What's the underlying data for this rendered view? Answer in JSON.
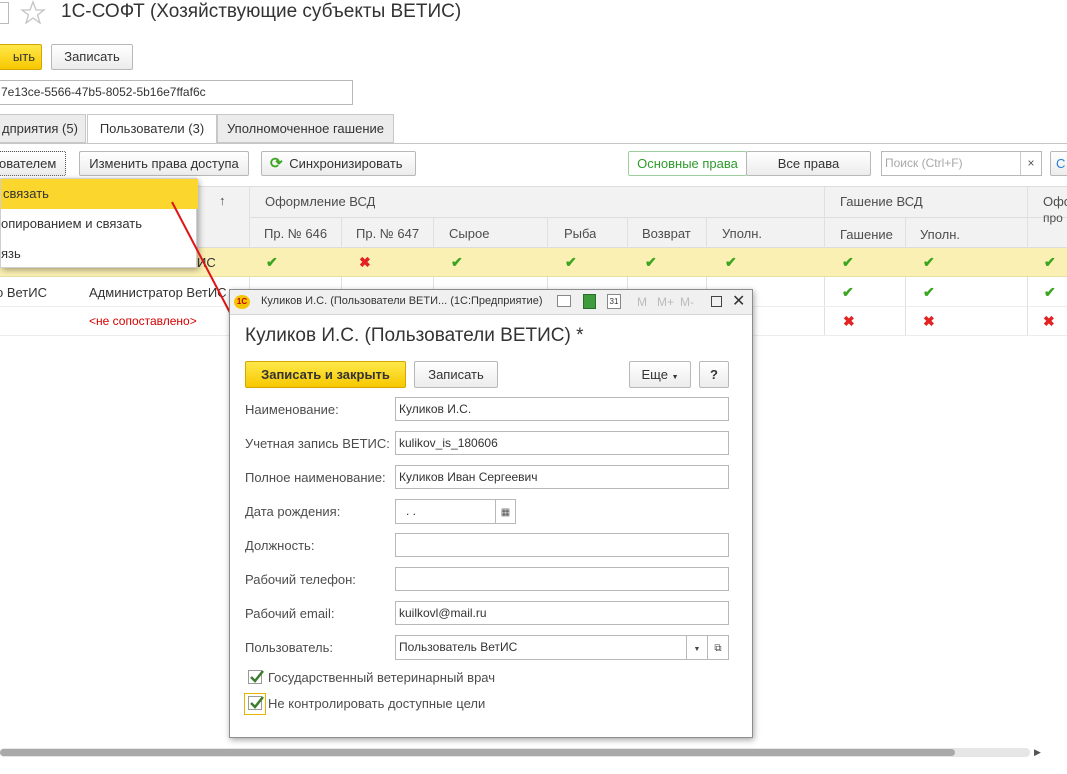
{
  "main": {
    "title": "1С-СОФТ (Хозяйствующие субъекты ВЕТИС)",
    "close_button": "ыть",
    "save_button": "Записать",
    "guid": "7e13ce-5566-47b5-8052-5b16e7ffaf6c",
    "tabs": [
      "дприятия (5)",
      "Пользователи (3)",
      "Уполномоченное гашение"
    ],
    "toolbar": {
      "user_dropdown": "ователем",
      "change_rights": "Изменить права доступа",
      "sync": "Синхронизировать",
      "basic_rights": "Основные права",
      "all_rights": "Все права",
      "search_placeholder": "Поиск (Ctrl+F)"
    },
    "context_menu": [
      "связать",
      "опированием и связать",
      "язь"
    ],
    "table": {
      "group_headers": [
        "Оформление ВСД",
        "Гашение ВСД",
        "Офо",
        "про"
      ],
      "sort_arrow": "↑",
      "columns": [
        "Пр. № 646",
        "Пр. № 647",
        "Сырое",
        "Рыба",
        "Возврат",
        "Уполн.",
        "Гашение",
        "Уполн."
      ],
      "rows": [
        {
          "name": "",
          "user": "ИС",
          "marks": [
            "yes",
            "no",
            "yes",
            "yes",
            "yes",
            "yes",
            "yes",
            "yes",
            "yes"
          ]
        },
        {
          "name": "о ВетИС",
          "user": "Администратор ВетИС",
          "marks": [
            "",
            "",
            "",
            "",
            "",
            "",
            "yes",
            "yes",
            "yes"
          ]
        },
        {
          "name": "",
          "user": "<не сопоставлено>",
          "marks": [
            "",
            "",
            "",
            "",
            "",
            "",
            "no",
            "no",
            "no"
          ]
        }
      ]
    }
  },
  "dialog": {
    "window_title": "Куликов И.С. (Пользователи ВЕТИ... (1С:Предприятие)",
    "heading": "Куликов И.С. (Пользователи ВЕТИС) *",
    "save_close_button": "Записать и закрыть",
    "save_button": "Записать",
    "more_button": "Еще",
    "help_button": "?",
    "titlebar_m": [
      "M",
      "M+",
      "M-"
    ],
    "fields": {
      "name_label": "Наименование:",
      "name_value": "Куликов И.С.",
      "account_label": "Учетная запись ВЕТИС:",
      "account_value": "kulikov_is_180606",
      "fullname_label": "Полное наименование:",
      "fullname_value": "Куликов Иван Сергеевич",
      "birth_label": "Дата рождения:",
      "birth_value": " .  .",
      "position_label": "Должность:",
      "position_value": "",
      "phone_label": "Рабочий телефон:",
      "phone_value": "",
      "email_label": "Рабочий email:",
      "email_value": "kuilkovl@mail.ru",
      "user_label": "Пользователь:",
      "user_value": "Пользователь ВетИС"
    },
    "checkboxes": [
      {
        "label": "Государственный ветеринарный врач",
        "checked": true
      },
      {
        "label": "Не контролировать доступные цели",
        "checked": true
      }
    ]
  },
  "colors": {
    "accent_yellow": "#f7c800",
    "check_green": "#3aa51f",
    "cross_red": "#e32222",
    "link_red": "#d40000",
    "arrow_red": "#e01414"
  }
}
